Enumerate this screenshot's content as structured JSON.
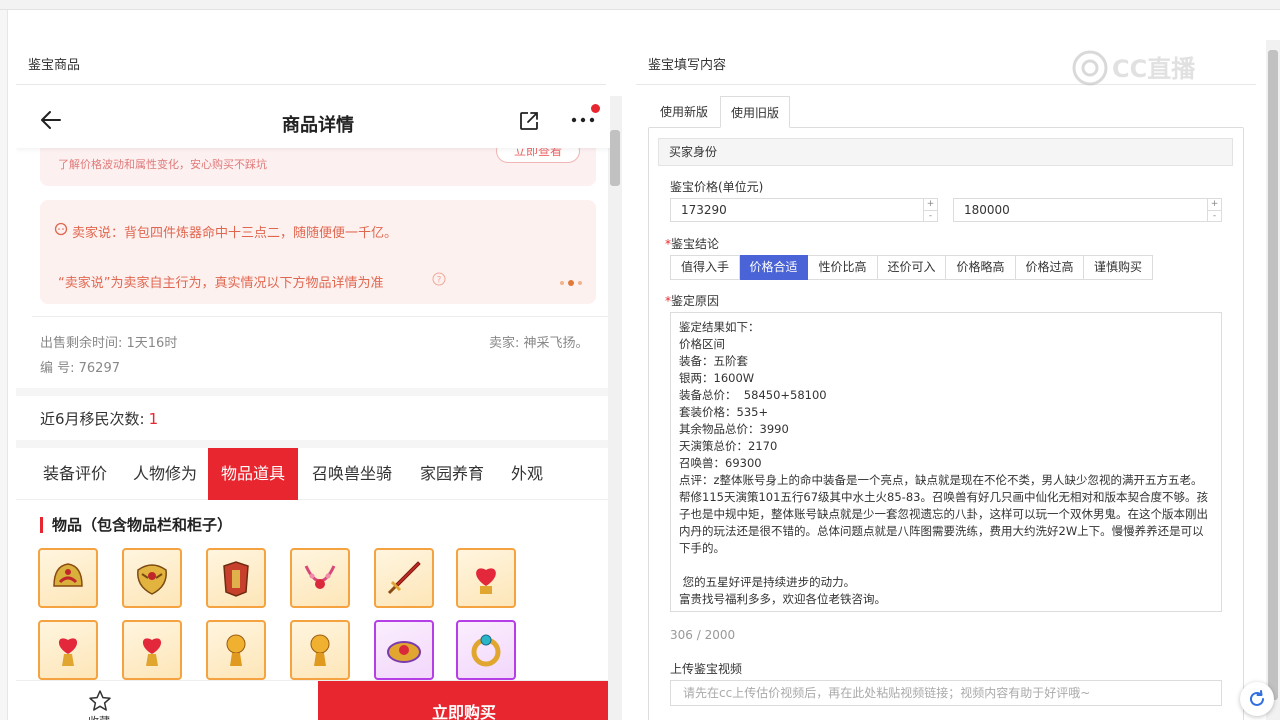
{
  "left_panel": {
    "title": "鉴宝商品",
    "header": {
      "title": "商品详情"
    },
    "price_card": {
      "text": "了解价格波动和属性变化，安心购买不踩坑",
      "button": "立即查看"
    },
    "seller_card": {
      "line1": "卖家说：背包四件炼器命中十三点二，随随便便一千亿。",
      "line2": "“卖家说”为卖家自主行为，真实情况以下方物品详情为准"
    },
    "info": {
      "time_left": "出售剩余时间: 1天16时",
      "seller": "卖家: 神采飞扬。",
      "serial": "编 号: 76297"
    },
    "migration": {
      "label": "近6月移民次数:",
      "count": "1"
    },
    "tabs": [
      "装备评价",
      "人物修为",
      "物品道具",
      "召唤兽坐骑",
      "家园养育",
      "外观"
    ],
    "active_tab": "物品道具",
    "section_title": "物品（包含物品栏和柜子）",
    "bottom": {
      "fav_label": "收藏",
      "buy_button": "立即购买"
    }
  },
  "right_panel": {
    "title": "鉴宝填写内容",
    "watermark": "CC直播",
    "tabs": [
      "使用新版",
      "使用旧版"
    ],
    "active_tab": "使用旧版",
    "box_title": "买家身份",
    "price_label": "鉴宝价格(单位元)",
    "price_min": "173290",
    "price_max": "180000",
    "conclusion_label": "鉴宝结论",
    "conclusions": [
      "值得入手",
      "价格合适",
      "性价比高",
      "还价可入",
      "价格略高",
      "价格过高",
      "谨慎购买"
    ],
    "active_conclusion": "价格合适",
    "reason_label": "鉴定原因",
    "reason_lines": [
      "鉴定结果如下：",
      "价格区间",
      "装备：五阶套",
      "银两：1600W",
      "装备总价：  58450+58100",
      "套装价格：535+",
      "其余物品总价：3990",
      "天演策总价：2170",
      "召唤兽：69300",
      "点评：z整体账号身上的命中装备是一个亮点，缺点就是现在不伦不类，男人缺少忽视的满开五方五老。帮修115天演策101五行67级其中水土火85-83。召唤兽有好几只画中仙化无相对和版本契合度不够。孩子也是中规中矩，整体账号缺点就是少一套忽视遗忘的八卦，这样可以玩一个双休男鬼。在这个版本刚出内丹的玩法还是很不错的。总体问题点就是八阵图需要洗练，费用大约洗好2W上下。慢慢养养还是可以下手的。",
      "",
      " 您的五星好评是持续进步的动力。",
      "富贵找号福利多多，欢迎各位老铁咨询。"
    ],
    "char_count": "306 / 2000",
    "video_label": "上传鉴宝视频",
    "video_placeholder": "请先在cc上传估价视频后，再在此处粘贴视频链接；视频内容有助于好评哦~"
  }
}
